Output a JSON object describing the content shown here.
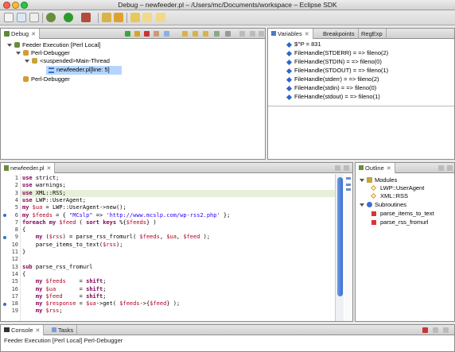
{
  "window": {
    "title": "Debug – newfeeder.pl – /Users/mc/Documents/workspace – Eclipse SDK"
  },
  "debug_view": {
    "tab_label": "Debug",
    "tree": [
      {
        "label": "Feeder Execution [Perl Local]"
      },
      {
        "label": "Perl-Debugger"
      },
      {
        "label": "<suspended>Main-Thread"
      },
      {
        "label": "newfeeder.pl[line: 5]"
      },
      {
        "label": "Perl-Debugger"
      }
    ]
  },
  "variables_view": {
    "tabs": [
      "Variables",
      "Breakpoints",
      "RegExp"
    ],
    "items": [
      "$^P = 831",
      "FileHandle(STDERR) = => fileno(2)",
      "FileHandle(STDIN) = => fileno(0)",
      "FileHandle(STDOUT) = => fileno(1)",
      "FileHandle(stderr) = => fileno(2)",
      "FileHandle(stdin) = => fileno(0)",
      "FileHandle(stdout) = => fileno(1)"
    ]
  },
  "editor": {
    "tab_label": "newfeeder.pl",
    "line_numbers": [
      "1",
      "2",
      "3",
      "4",
      "5",
      "6",
      "7",
      "8",
      "9",
      "10",
      "11",
      "12",
      "13",
      "14",
      "15",
      "16",
      "17",
      "18",
      "19"
    ],
    "lines": [
      "use strict;",
      "use warnings;",
      "use XML::RSS;",
      "use LWP::UserAgent;",
      "my $ua = LWP::UserAgent->new();",
      "my $feeds = { \"MCslp\" => 'http://www.mcslp.com/wp-rss2.php' };",
      "foreach my $feed ( sort keys %{$feeds} )",
      "{",
      "    my ($rss) = parse_rss_fromurl( $feeds, $ua, $feed );",
      "    parse_items_to_text($rss);",
      "}",
      "",
      "sub parse_rss_fromurl",
      "{",
      "    my $feeds    = shift;",
      "    my $ua       = shift;",
      "    my $feed     = shift;",
      "    my $response = $ua->get( $feeds->{$feed} );",
      "    my $rss;"
    ]
  },
  "outline_view": {
    "tab_label": "Outline",
    "items": [
      {
        "label": "Modules"
      },
      {
        "label": "LWP::UserAgent"
      },
      {
        "label": "XML::RSS"
      },
      {
        "label": "Subroutines"
      },
      {
        "label": "parse_items_to_text"
      },
      {
        "label": "parse_rss_fromurl"
      }
    ]
  },
  "bottom_panel": {
    "tabs": [
      "Console",
      "Tasks"
    ],
    "status": "Feeder Execution [Perl Local] Perl-Debugger"
  },
  "colors": {
    "keyword": "#7f0055",
    "variable": "#b00020",
    "string": "#2a00ff",
    "current_line": "#e6f0d8",
    "selection": "#b5d5ff",
    "breakpoint": "#3a6fc4"
  }
}
